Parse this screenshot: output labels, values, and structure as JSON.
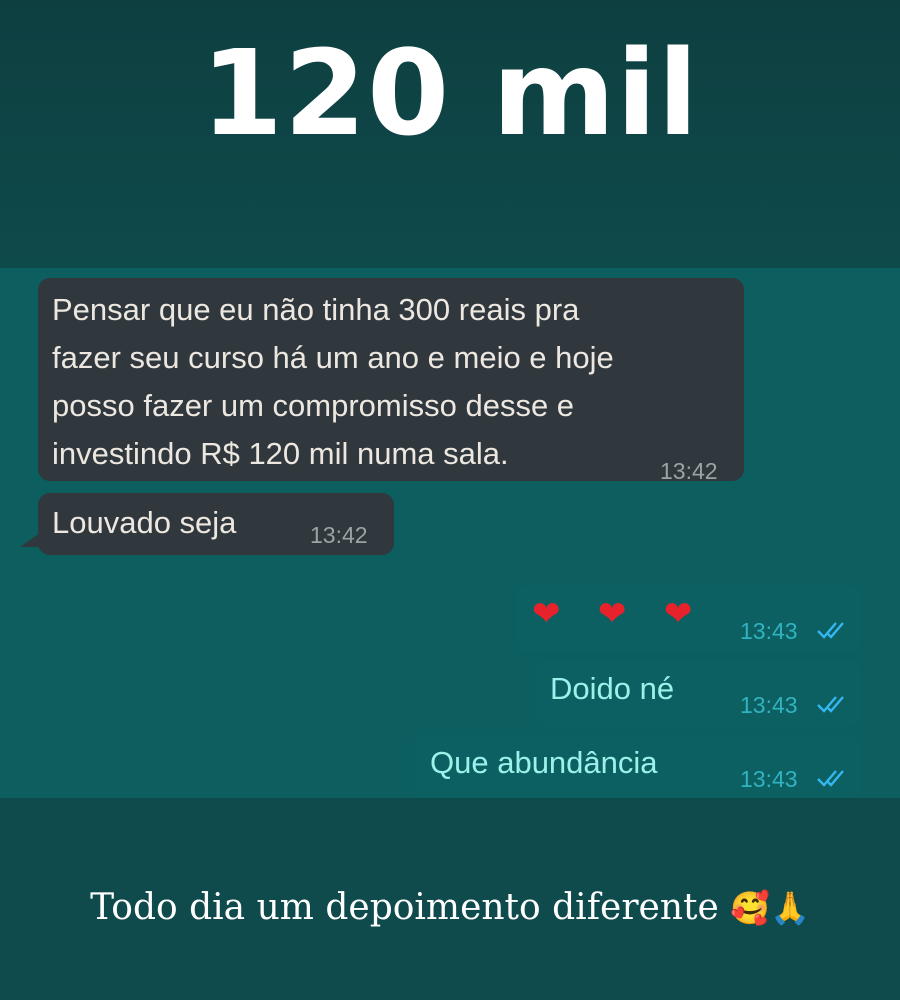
{
  "headline": "120 mil",
  "messages": [
    {
      "direction": "incoming",
      "text_lines": [
        "Pensar que eu não tinha 300 reais pra",
        "fazer seu curso há um ano e meio e hoje",
        "posso fazer um compromisso desse e",
        "investindo R$ 120 mil numa sala."
      ],
      "time": "13:42"
    },
    {
      "direction": "incoming",
      "text": "Louvado seja",
      "time": "13:42"
    },
    {
      "direction": "outgoing",
      "text": "❤ ❤ ❤",
      "time": "13:43",
      "read_icon": "double-check-icon"
    },
    {
      "direction": "outgoing",
      "text": "Doido né",
      "time": "13:43",
      "read_icon": "double-check-icon"
    },
    {
      "direction": "outgoing",
      "text": "Que abundância",
      "time": "13:43",
      "read_icon": "double-check-icon"
    }
  ],
  "footer": {
    "caption": "Todo dia um depoimento diferente",
    "emoji": "🥰🙏"
  },
  "colors": {
    "incoming_bubble": "#30383d",
    "outgoing_text": "#9ff0ea",
    "read_ticks": "#34b7f1",
    "chat_background": "#0c5e5f"
  }
}
